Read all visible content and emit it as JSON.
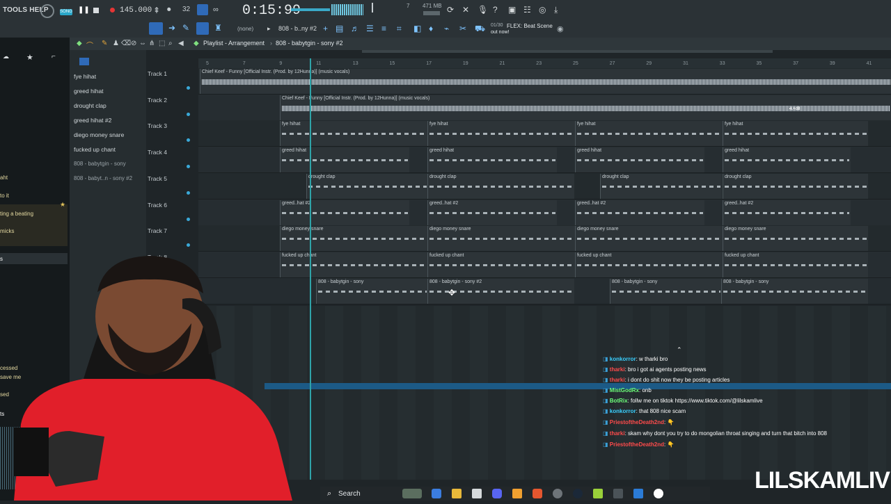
{
  "menu": {
    "tools_help": "TOOLS HELP"
  },
  "transport": {
    "tempo": "145.000",
    "time": "0:15:99",
    "mem": "471 MB",
    "song_label": "SONG",
    "counter": "7"
  },
  "toolbar2": {
    "pattern_none": "(none)",
    "pattern_name": "808 - b..ny #2",
    "news_counter": "01/30",
    "news_text": "FLEX: Beat Scene",
    "news_sub": "out now!"
  },
  "playlist": {
    "title": "Playlist - Arrangement",
    "breadcrumb": "808 - babytgin - sony #2"
  },
  "ruler_ticks": [
    "5",
    "7",
    "9",
    "11",
    "13",
    "15",
    "17",
    "19",
    "21",
    "23",
    "25",
    "27",
    "29",
    "31",
    "33",
    "35",
    "37",
    "39",
    "41"
  ],
  "picker_items": [
    "fye hihat",
    "greed hihat",
    "drought clap",
    "greed hihat #2",
    "diego money snare",
    "fucked up chant",
    "808 - babytgin - sony",
    "808 - babyt..n - sony #2"
  ],
  "tracks": [
    {
      "label": "Track 1",
      "clip": "Chief Keef - Funny [Official Instr. (Prod. by 12Hunna)] (music vocals)"
    },
    {
      "label": "Track 2",
      "clip": "Chief Keef - Funny [Official Instr. (Prod. by 12Hunna)] (music vocals)"
    },
    {
      "label": "Track 3",
      "clip": "fye hihat"
    },
    {
      "label": "Track 4",
      "clip": "greed hihat"
    },
    {
      "label": "Track 5",
      "clip": "drought clap"
    },
    {
      "label": "Track 6",
      "clip": "greed..hat #2"
    },
    {
      "label": "Track 7",
      "clip": "diego money snare"
    },
    {
      "label": "Track 8",
      "clip": "fucked up chant"
    }
  ],
  "clip_808": "808 - babytgin - sony",
  "clip_808_2": "808 - babytgin - sony #2",
  "track2_db": "4.4dB",
  "chat": [
    {
      "user": "konkorror",
      "color": "u",
      "msg": ": w tharki bro"
    },
    {
      "user": "tharki",
      "color": "r",
      "msg": ": bro i got ai agents posting news"
    },
    {
      "user": "tharki",
      "color": "r",
      "msg": ": i dont do shit now they be posting articles"
    },
    {
      "user": "MistGodRx",
      "color": "g",
      "msg": ": onb"
    },
    {
      "user": "BotRix",
      "color": "g",
      "msg": ": follw me on tiktok https://www.tiktok.com/@lilskamlive"
    },
    {
      "user": "konkorror",
      "color": "u",
      "msg": ": that 808 nice scam"
    },
    {
      "user": "PriestoftheDeath2nd",
      "color": "r",
      "msg": ": 👇"
    },
    {
      "user": "tharki",
      "color": "r",
      "msg": ": skam why dont you try to do mongolian throat singing and turn that bitch into 808"
    },
    {
      "user": "PriestoftheDeath2nd",
      "color": "r",
      "msg": ": 👇"
    }
  ],
  "left_fragments": [
    "aht",
    "to it",
    "ting a beating",
    "micks",
    "s",
    "cessed",
    "save me",
    "sed",
    "ts"
  ],
  "taskbar": {
    "search": "Search"
  },
  "watermark": "LILSKAMLIVE"
}
